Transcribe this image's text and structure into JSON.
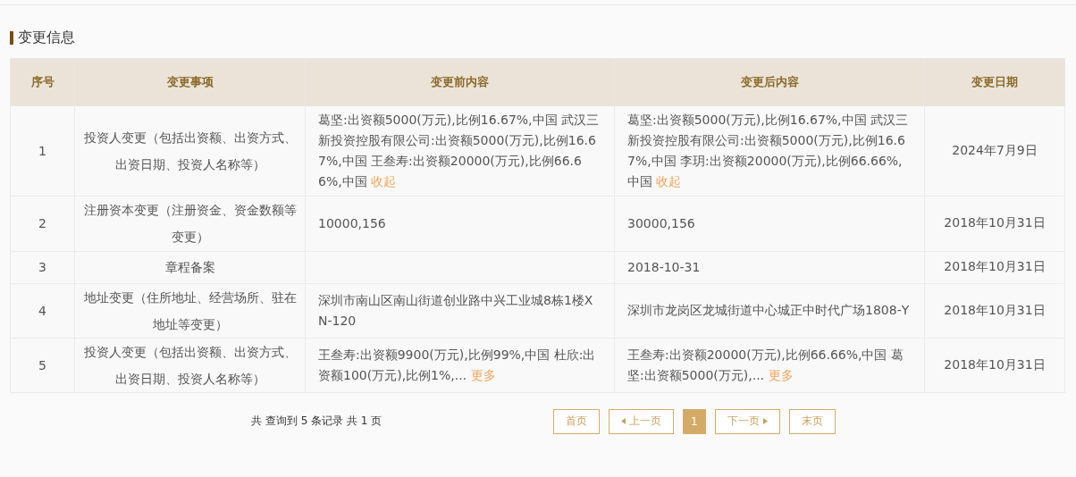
{
  "section": {
    "title": "变更信息"
  },
  "table": {
    "columns": [
      "序号",
      "变更事项",
      "变更前内容",
      "变更后内容",
      "变更日期"
    ],
    "rows": [
      {
        "index": "1",
        "item": "投资人变更（包括出资额、出资方式、出资日期、投资人名称等）",
        "before": {
          "text": "葛坚:出资额5000(万元),比例16.67%,中国 武汉三新投资控股有限公司:出资额5000(万元),比例16.67%,中国 王叁寿:出资额20000(万元),比例66.66%,中国",
          "link": "收起"
        },
        "after": {
          "text": "葛坚:出资额5000(万元),比例16.67%,中国 武汉三新投资控股有限公司:出资额5000(万元),比例16.67%,中国 李玥:出资额20000(万元),比例66.66%,中国",
          "link": "收起"
        },
        "date": "2024年7月9日"
      },
      {
        "index": "2",
        "item": "注册资本变更（注册资金、资金数额等变更）",
        "before": {
          "text": "10000,156"
        },
        "after": {
          "text": "30000,156"
        },
        "date": "2018年10月31日"
      },
      {
        "index": "3",
        "item": "章程备案",
        "before": {},
        "after": {
          "text": "2018-10-31"
        },
        "date": "2018年10月31日"
      },
      {
        "index": "4",
        "item": "地址变更（住所地址、经营场所、驻在地址等变更）",
        "before": {
          "text": "深圳市南山区南山街道创业路中兴工业城8栋1楼XN-120"
        },
        "after": {
          "text": "深圳市龙岗区龙城街道中心城正中时代广场1808-Y"
        },
        "date": "2018年10月31日"
      },
      {
        "index": "5",
        "item": "投资人变更（包括出资额、出资方式、出资日期、投资人名称等）",
        "before": {
          "text": "王叁寿:出资额9900(万元),比例99%,中国 杜欣:出资额100(万元),比例1%,...",
          "link": "更多"
        },
        "after": {
          "text": "王叁寿:出资额20000(万元),比例66.66%,中国 葛坚:出资额5000(万元),...",
          "link": "更多"
        },
        "date": "2018年10月31日"
      }
    ]
  },
  "pagination": {
    "summary": "共 查询到 5 条记录 共 1 页",
    "buttons": [
      {
        "kind": "first",
        "label": "首页",
        "selected": false
      },
      {
        "kind": "prev",
        "label": "上一页",
        "selected": false
      },
      {
        "kind": "page",
        "label": "1",
        "selected": true
      },
      {
        "kind": "next",
        "label": "下一页",
        "selected": false
      },
      {
        "kind": "last",
        "label": "末页",
        "selected": false
      }
    ]
  }
}
